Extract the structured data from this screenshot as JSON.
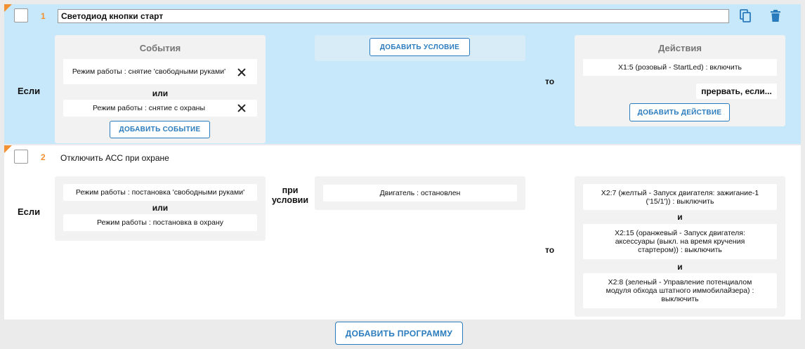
{
  "colors": {
    "accent": "#f29131",
    "primary": "#2a7bbd",
    "selected_bg": "#c7e7fa"
  },
  "programs": [
    {
      "number": "1",
      "name": "Светодиод кнопки старт",
      "if_label": "Если",
      "then_label": "то",
      "events_title": "События",
      "events": [
        "Режим работы : снятие 'свободными руками'",
        "Режим работы : снятие с охраны"
      ],
      "or_label": "или",
      "add_event_label": "ДОБАВИТЬ СОБЫТИЕ",
      "add_condition_label": "ДОБАВИТЬ УСЛОВИЕ",
      "actions_title": "Действия",
      "actions": [
        "X1:5 (розовый - StartLed) : включить"
      ],
      "abort_label": "прервать, если...",
      "add_action_label": "ДОБАВИТЬ ДЕЙСТВИЕ",
      "icons": {
        "copy": "copy-icon",
        "delete": "trash-icon",
        "remove": "close-icon"
      }
    },
    {
      "number": "2",
      "name": "Отключить АСС при охране",
      "if_label": "Если",
      "then_label": "то",
      "condition_label": "при условии",
      "events": [
        "Режим работы : постановка 'свободными руками'",
        "Режим работы : постановка в охрану"
      ],
      "or_label": "или",
      "conditions": [
        "Двигатель : остановлен"
      ],
      "and_label": "и",
      "actions": [
        "X2:7 (желтый - Запуск двигателя: зажигание-1 ('15/1')) : выключить",
        "X2:15 (оранжевый - Запуск двигателя: аксессуары (выкл. на время кручения стартером)) : выключить",
        "X2:8 (зеленый - Управление потенциалом модуля обхода штатного иммобилайзера) : выключить"
      ]
    }
  ],
  "add_program_label": "ДОБАВИТЬ ПРОГРАММУ"
}
